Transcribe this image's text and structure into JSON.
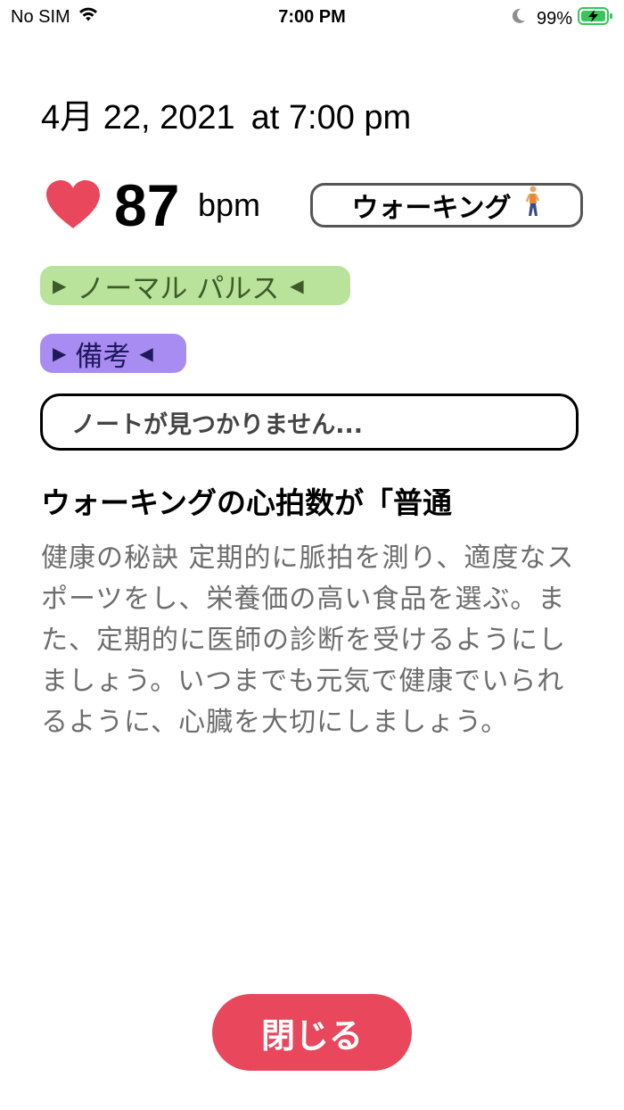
{
  "status_bar": {
    "carrier": "No SIM",
    "time": "7:00 PM",
    "battery_percent": "99%",
    "wifi_icon": "wifi-icon",
    "moon_icon": "moon-icon",
    "battery_icon": "battery-charging-icon"
  },
  "reading": {
    "date": "4月 22, 2021",
    "time": "at 7:00 pm",
    "bpm": "87",
    "unit": "bpm",
    "activity": "ウォーキング",
    "activity_icon": "walking-person-icon",
    "heart_color": "#e8475c"
  },
  "tags": {
    "pulse_label": "ノーマル パルス",
    "notes_label": "備考"
  },
  "notes": {
    "text": "ノートが見つかりません..."
  },
  "info": {
    "heading": "ウォーキングの心拍数が「普通",
    "body": "健康の秘訣 定期的に脈拍を測り、適度なスポーツをし、栄養価の高い食品を選ぶ。また、定期的に医師の診断を受けるようにしましょう。いつまでも元気で健康でいられるように、心臓を大切にしましょう。"
  },
  "actions": {
    "close_label": "閉じる"
  },
  "colors": {
    "accent": "#e8475c",
    "normal_tag_bg": "#b9e39a",
    "notes_tag_bg": "#a98cf2"
  }
}
